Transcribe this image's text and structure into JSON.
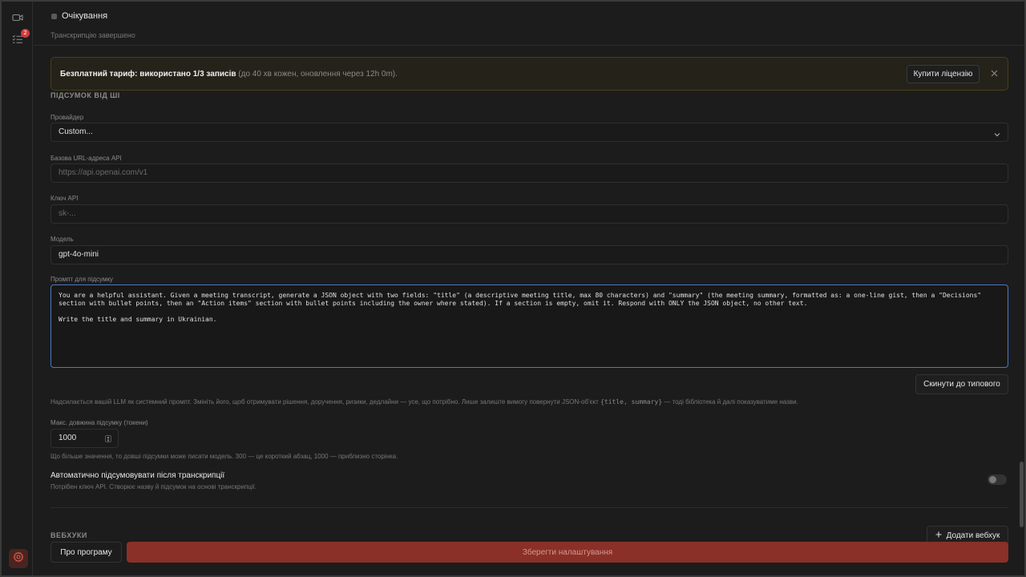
{
  "status": {
    "title": "Очікування",
    "subtitle": "Транскрипцію завершено"
  },
  "rail": {
    "tasks_badge": "2"
  },
  "banner": {
    "bold": "Безплатний тариф: використано 1/3 записів",
    "muted": " (до 40 хв кожен, оновлення через 12h 0m).",
    "buy_label": "Купити ліцензію"
  },
  "ai_summary": {
    "section_title": "ПІДСУМОК ВІД ШІ",
    "provider_label": "Провайдер",
    "provider_value": "Custom...",
    "base_url_label": "Базова URL-адреса API",
    "base_url_placeholder": "https://api.openai.com/v1",
    "api_key_label": "Ключ API",
    "api_key_placeholder": "sk-...",
    "model_label": "Модель",
    "model_value": "gpt-4o-mini",
    "prompt_label": "Промпт для підсумку",
    "prompt_value": "You are a helpful assistant. Given a meeting transcript, generate a JSON object with two fields: \"title\" (a descriptive meeting title, max 80 characters) and \"summary\" (the meeting summary, formatted as: a one-line gist, then a \"Decisions\"\nsection with bullet points, then an \"Action items\" section with bullet points including the owner where stated). If a section is empty, omit it. Respond with ONLY the JSON object, no other text.\n\nWrite the title and summary in Ukrainian.",
    "reset_label": "Скинути до типового",
    "prompt_hint_before": "Надсилається вашій LLM як системний промпт. Змініть його, щоб отримувати рішення, доручення, ризики, дедлайни — усе, що потрібно. Лише залиште вимогу повернути JSON-об'єкт ",
    "prompt_hint_code": "{title, summary}",
    "prompt_hint_after": " — тоді бібліотека й далі показуватиме назви.",
    "max_len_label": "Макс. довжина підсумку (токени)",
    "max_len_value": "1000",
    "max_len_hint": "Що більше значення, то довші підсумки може писати модель. 300 — це короткий абзац, 1000 — приблизно сторінка.",
    "auto_label": "Автоматично підсумовувати після транскрипції",
    "auto_hint": "Потрібен ключ API. Створює назву й підсумок на основі транскрипції.",
    "auto_enabled": false
  },
  "webhooks": {
    "section_title": "ВЕБХУКИ",
    "add_label": "Додати вебхук"
  },
  "footer": {
    "about_label": "Про програму",
    "save_label": "Зберегти налаштування"
  },
  "colors": {
    "accent_save": "#8a3028",
    "focus_border": "#4a78c8",
    "badge": "#d23c3c"
  }
}
